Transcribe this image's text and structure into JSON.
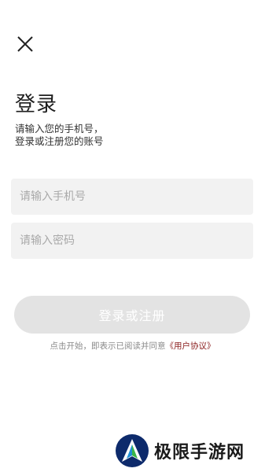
{
  "header": {
    "close_icon": "close-icon",
    "title": "登录",
    "subtitle_line1": "请输入您的手机号，",
    "subtitle_line2": "登录或注册您的账号"
  },
  "form": {
    "phone_placeholder": "请输入手机号",
    "phone_value": "",
    "password_placeholder": "请输入密码",
    "password_value": "",
    "submit_label": "登录或注册"
  },
  "agreement": {
    "prefix": "点击开始，即表示已阅读并同意",
    "link": "《用户协议》"
  },
  "watermark": {
    "text": "极限手游网"
  },
  "colors": {
    "field_bg": "#f2f2f2",
    "button_disabled": "#e3e3e3",
    "link": "#8b1d1d"
  }
}
